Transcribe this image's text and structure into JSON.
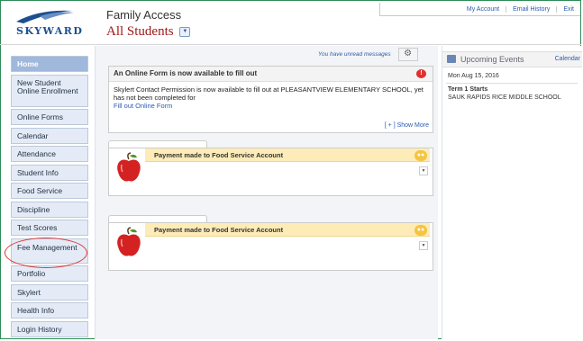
{
  "header": {
    "logo_text": "SKYWARD",
    "title": "Family Access",
    "student_selector": "All Students",
    "top_links": [
      "My Account",
      "Email History",
      "Exit"
    ]
  },
  "sidebar": {
    "items": [
      {
        "label": "Home"
      },
      {
        "label": "New Student Online Enrollment"
      },
      {
        "label": "Online Forms"
      },
      {
        "label": "Calendar"
      },
      {
        "label": "Attendance"
      },
      {
        "label": "Student Info"
      },
      {
        "label": "Food Service"
      },
      {
        "label": "Discipline"
      },
      {
        "label": "Test Scores"
      },
      {
        "label": "Fee Management"
      },
      {
        "label": "Portfolio"
      },
      {
        "label": "Skylert"
      },
      {
        "label": "Health Info"
      },
      {
        "label": "Login History"
      }
    ]
  },
  "main": {
    "unread_messages": "You have unread messages",
    "online_form": {
      "heading": "An Online Form is now available to fill out",
      "body": "Skylert Contact Permission is now available to fill out at PLEASANTVIEW ELEMENTARY SCHOOL, yet has not been completed for",
      "link": "Fill out Online Form",
      "show_more": "[ + ] Show More"
    },
    "cards": [
      {
        "title": "Payment made to Food Service Account"
      },
      {
        "title": "Payment made to Food Service Account"
      }
    ]
  },
  "events": {
    "title": "Upcoming Events",
    "calendar_link": "Calendar",
    "date": "Mon Aug 15, 2016",
    "event_title": "Term 1 Starts",
    "school": "SAUK RAPIDS RICE MIDDLE SCHOOL"
  },
  "colors": {
    "home_active": "#9fb8dc",
    "sidebar_item": "#e4ebf6",
    "student_selector": "#a01818",
    "card_title_bg": "#fdecb8",
    "annotation_circle": "#d83a3a"
  }
}
